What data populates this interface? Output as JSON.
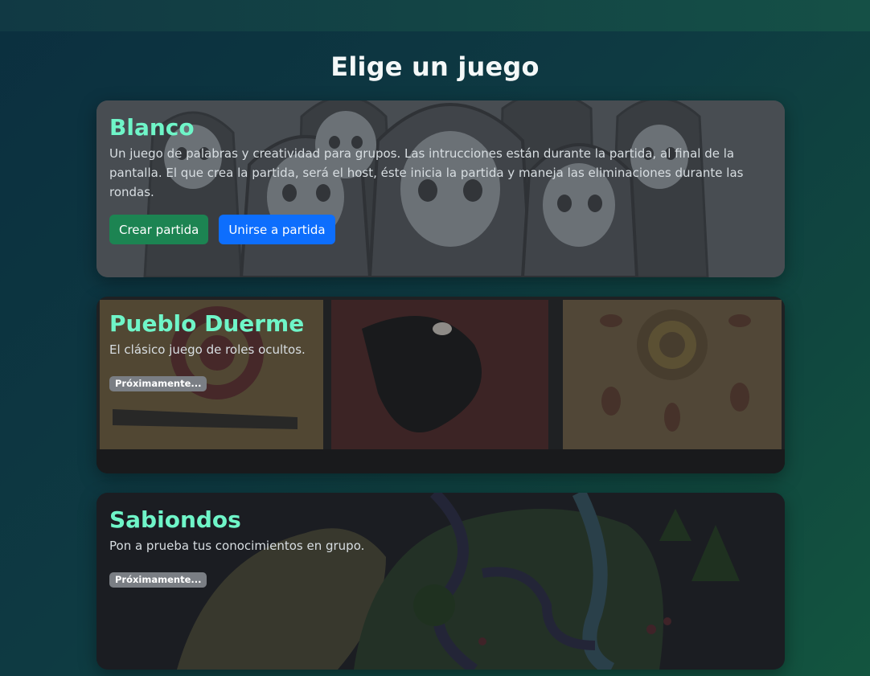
{
  "page": {
    "title": "Elige un juego"
  },
  "games": [
    {
      "title": "Blanco",
      "description": "Un juego de palabras y creatividad para grupos. Las intrucciones están durante la partida, al final de la pantalla. El que crea la partida, será el host, éste inicia la partida y maneja las eliminaciones durante las rondas.",
      "create_label": "Crear partida",
      "join_label": "Unirse a partida"
    },
    {
      "title": "Pueblo Duerme",
      "description": "El clásico juego de roles ocultos.",
      "badge": "Próximamente..."
    },
    {
      "title": "Sabiondos",
      "description": "Pon a prueba tus conocimientos en grupo.",
      "badge": "Próximamente..."
    }
  ],
  "colors": {
    "title_accent": "#6ff5c8",
    "create_button": "#1c8452",
    "join_button": "#0d6efd",
    "badge": "#7a7e84"
  }
}
